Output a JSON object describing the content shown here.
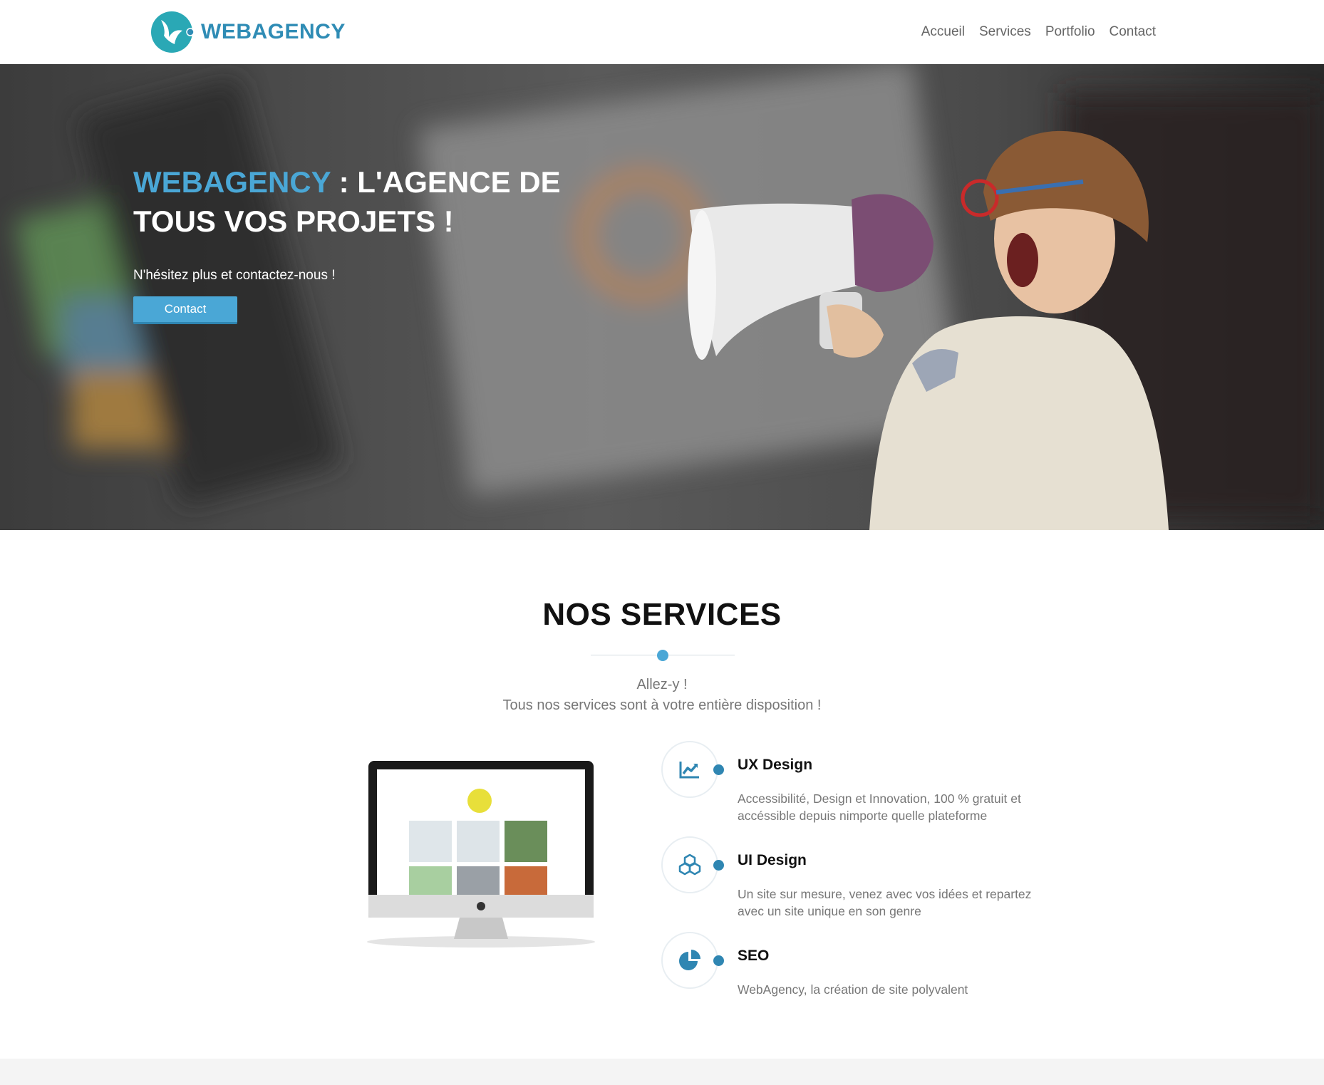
{
  "brand": {
    "name": "WEBAGENCY",
    "color": "#2f8cb5"
  },
  "nav": {
    "items": [
      {
        "label": "Accueil"
      },
      {
        "label": "Services"
      },
      {
        "label": "Portfolio"
      },
      {
        "label": "Contact"
      }
    ]
  },
  "hero": {
    "title_brand": "WEBAGENCY",
    "title_rest": " : L'AGENCE DE TOUS VOS PROJETS !",
    "subtitle": "N'hésitez plus et contactez-nous !",
    "button_label": "Contact",
    "accent": "#4aa7d6"
  },
  "services": {
    "title": "NOS SERVICES",
    "intro_line1": "Allez-y !",
    "intro_line2": "Tous nos services sont à votre entière disposition !",
    "items": [
      {
        "icon": "chart-line-icon",
        "name": "UX Design",
        "desc": "Accessibilité, Design et Innovation, 100 % gratuit et accéssible depuis nimporte quelle plateforme"
      },
      {
        "icon": "cubes-icon",
        "name": "UI Design",
        "desc": "Un site sur mesure, venez avec vos idées et repartez avec un site unique en son genre"
      },
      {
        "icon": "pie-chart-icon",
        "name": "SEO",
        "desc": "WebAgency, la création de site polyvalent"
      }
    ]
  }
}
